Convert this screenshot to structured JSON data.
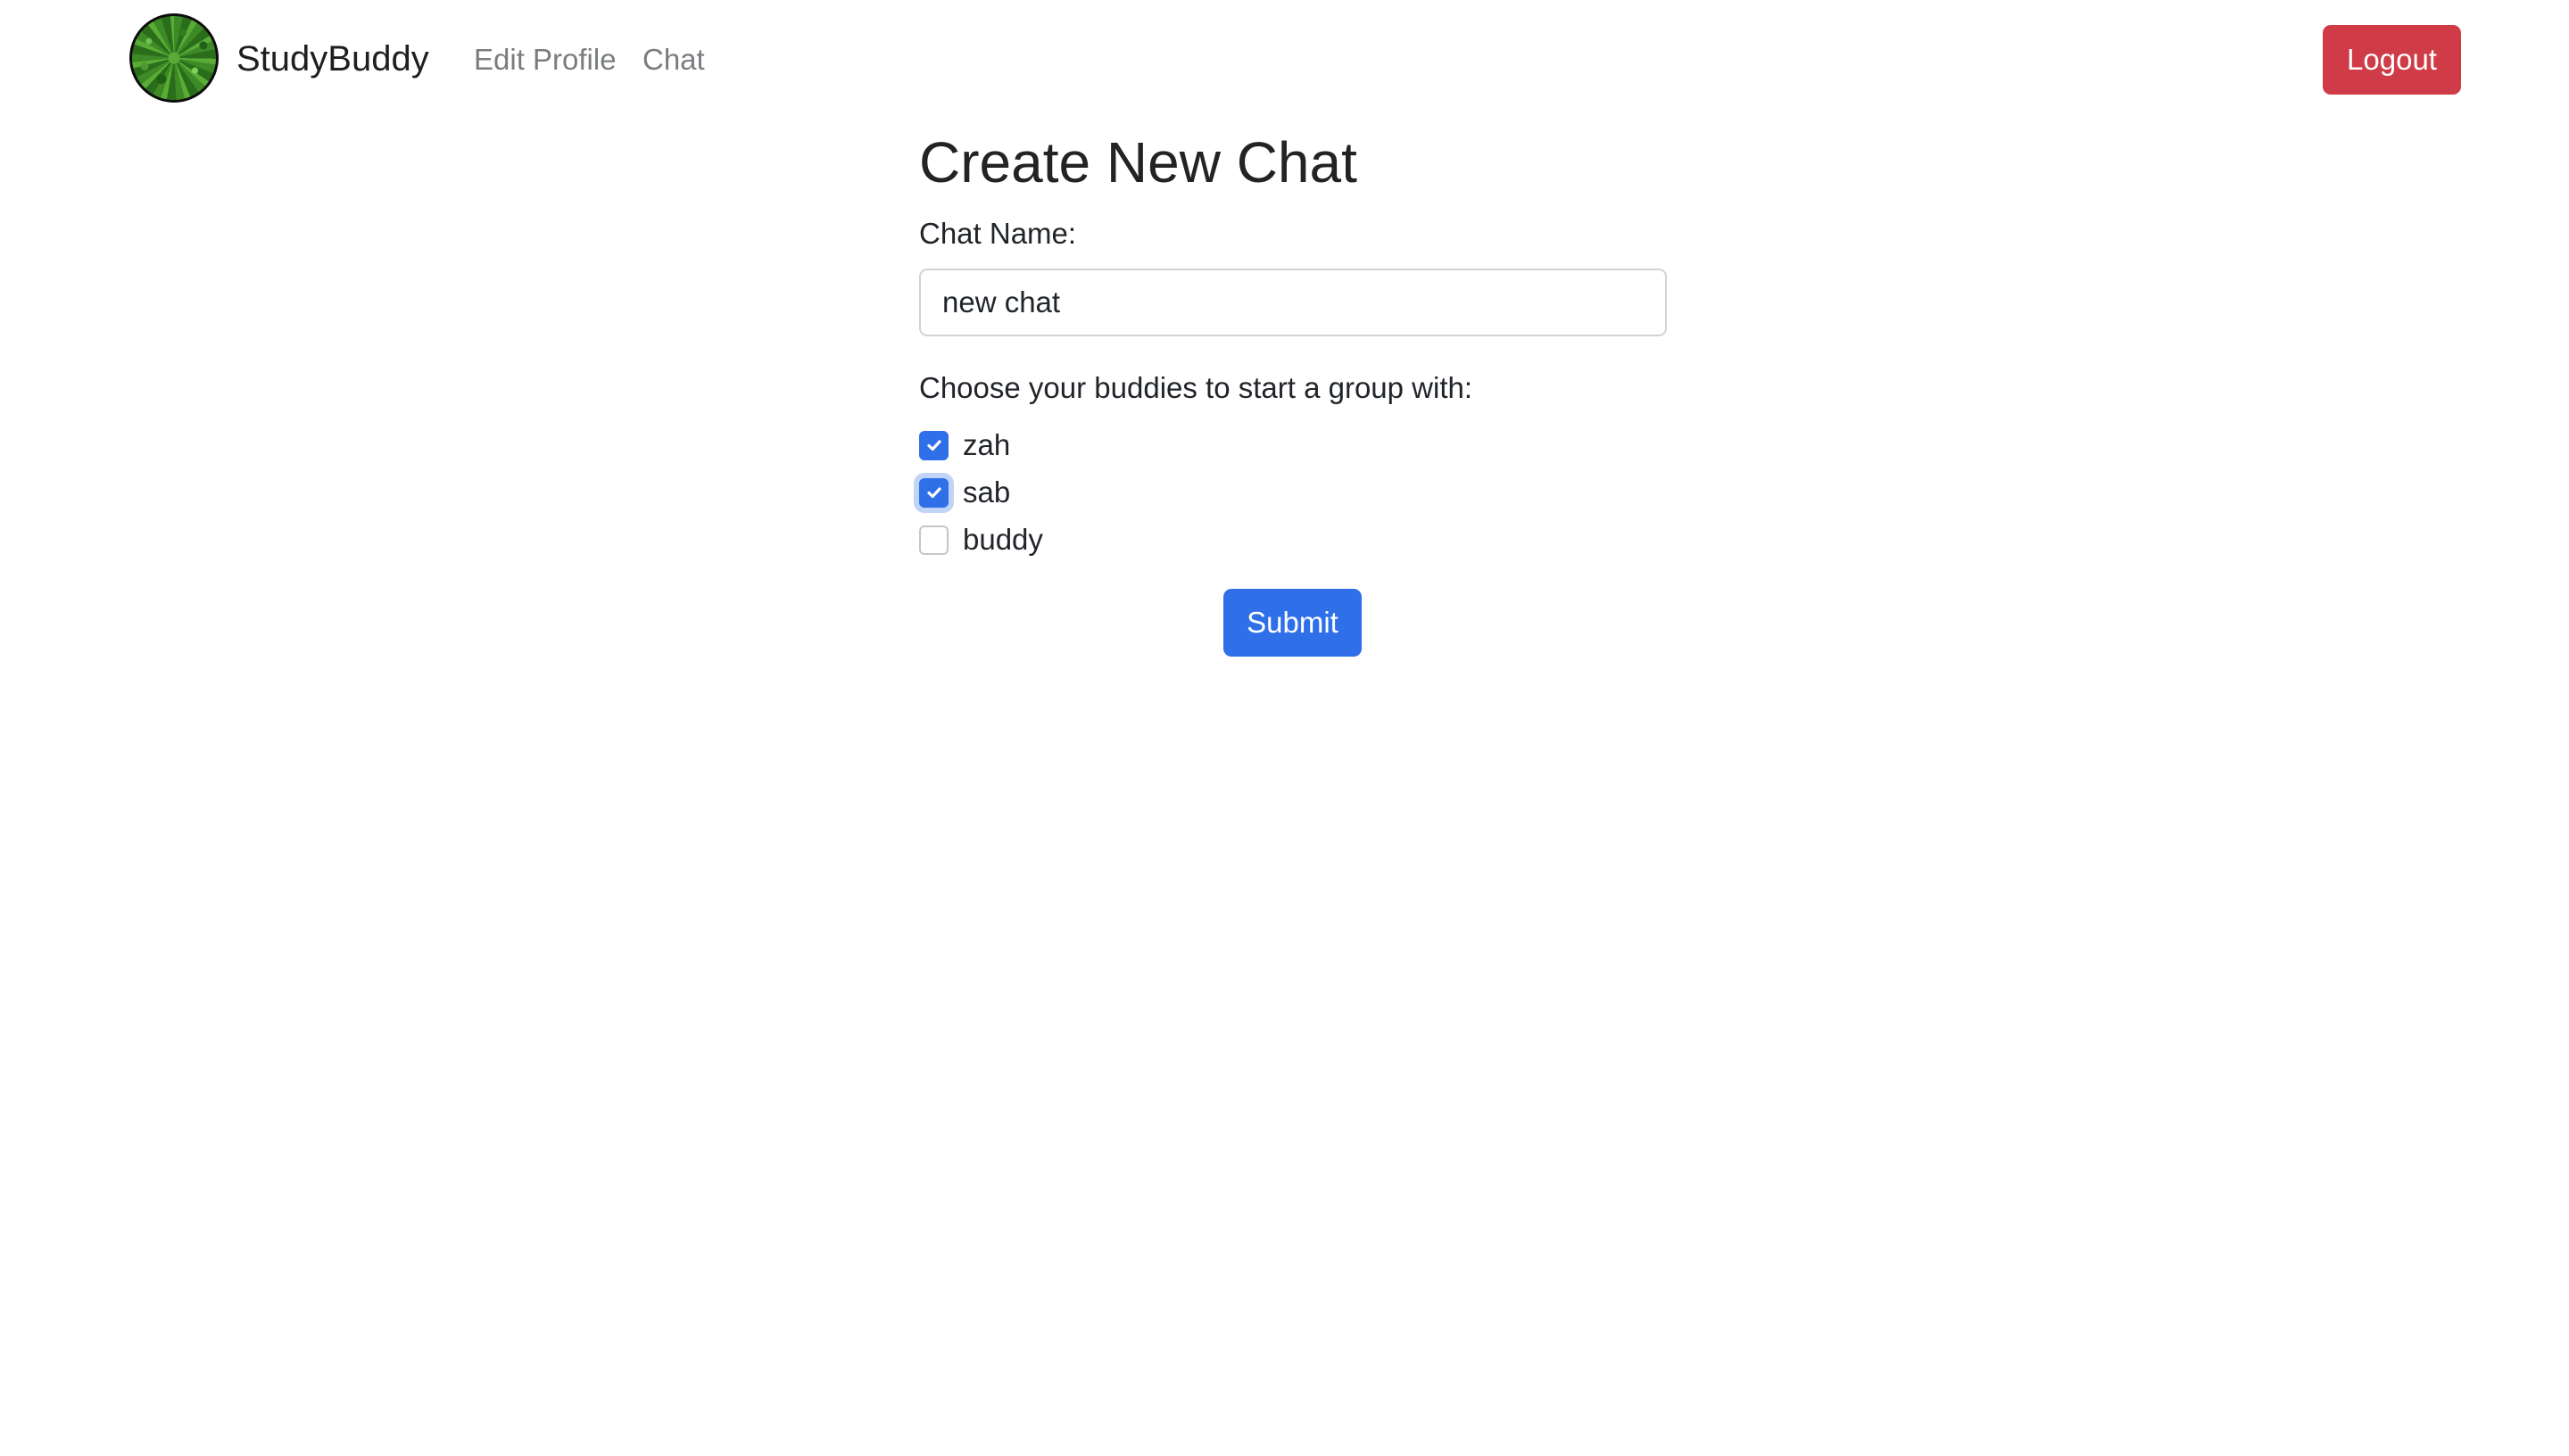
{
  "nav": {
    "brand": "StudyBuddy",
    "links": [
      {
        "label": "Edit Profile"
      },
      {
        "label": "Chat"
      }
    ],
    "logout_label": "Logout",
    "logout_color": "#cf3b46"
  },
  "form": {
    "title": "Create New Chat",
    "chat_name_label": "Chat Name:",
    "chat_name_value": "new chat",
    "buddies_label": "Choose your buddies to start a group with:",
    "buddies": [
      {
        "name": "zah",
        "checked": true
      },
      {
        "name": "sab",
        "checked": true,
        "focused": true
      },
      {
        "name": "buddy",
        "checked": false
      }
    ],
    "submit_label": "Submit",
    "accent_color": "#2f6fe8"
  }
}
